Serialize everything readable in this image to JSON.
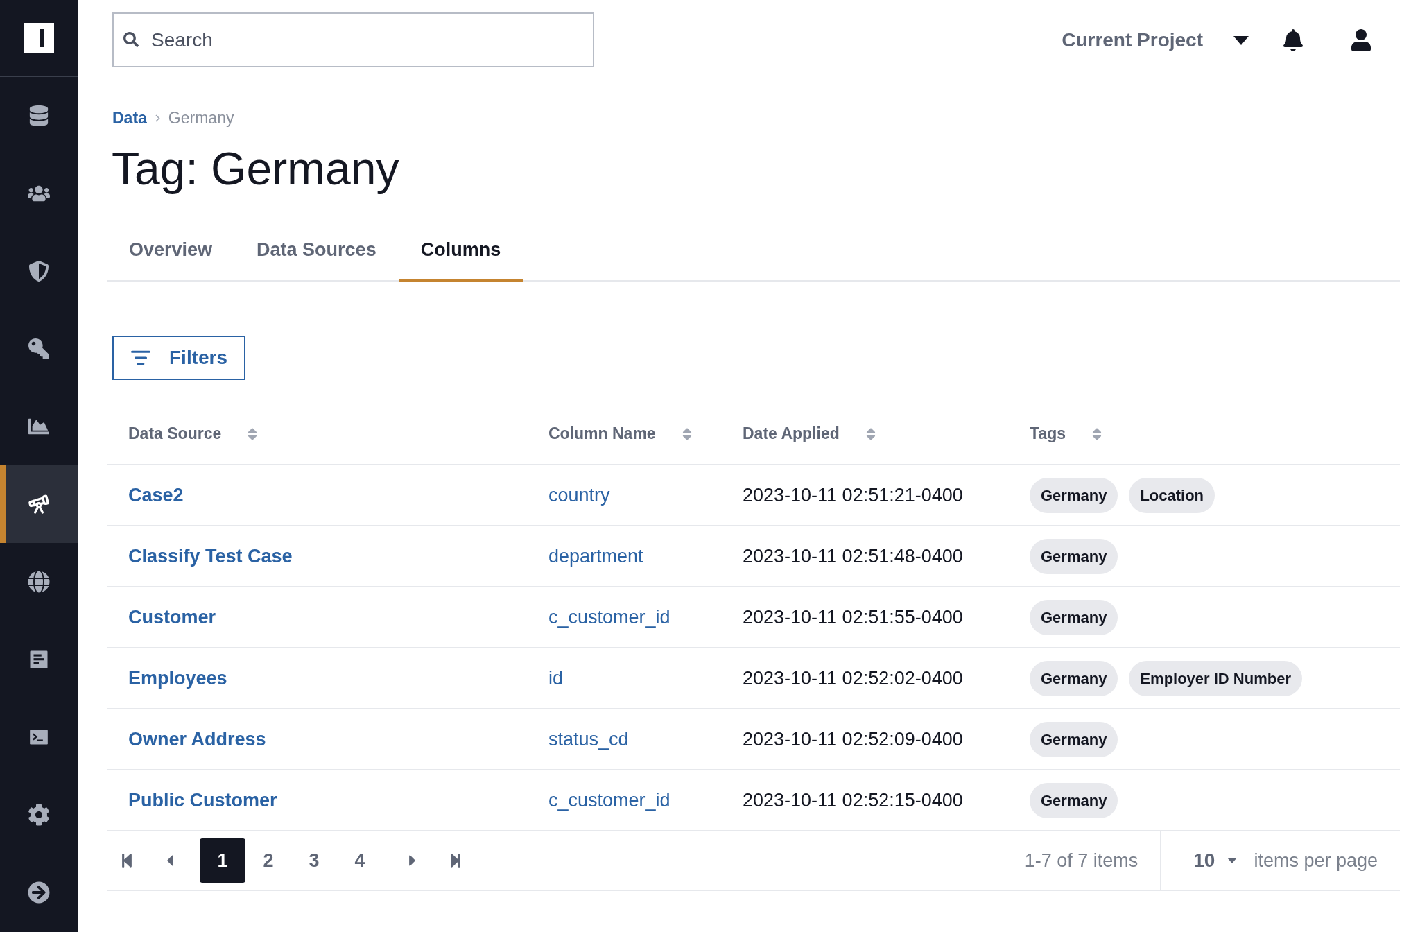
{
  "sidebar": {
    "items": [
      {
        "selected": false
      },
      {
        "selected": false
      },
      {
        "selected": false
      },
      {
        "selected": false
      },
      {
        "selected": false
      },
      {
        "selected": true
      },
      {
        "selected": false
      },
      {
        "selected": false
      },
      {
        "selected": false
      },
      {
        "selected": false
      },
      {
        "selected": false
      }
    ]
  },
  "header": {
    "search": {
      "placeholder": "Search"
    },
    "project": "Current Project"
  },
  "breadcrumb": [
    "Data",
    "Germany"
  ],
  "title": "Tag: Germany",
  "tabs": [
    {
      "label": "Overview",
      "selected": false
    },
    {
      "label": "Data Sources",
      "selected": false
    },
    {
      "label": "Columns",
      "selected": true
    }
  ],
  "filters_button": "Filters",
  "table": {
    "columns": [
      "Data Source",
      "Column Name",
      "Date Applied",
      "Tags"
    ],
    "rows": [
      {
        "data_source": "Case2",
        "column_name": "country",
        "date_applied": "2023-10-11 02:51:21-0400",
        "tags": [
          "Germany",
          "Location"
        ]
      },
      {
        "data_source": "Classify Test Case",
        "column_name": "department",
        "date_applied": "2023-10-11 02:51:48-0400",
        "tags": [
          "Germany"
        ]
      },
      {
        "data_source": "Customer",
        "column_name": "c_customer_id",
        "date_applied": "2023-10-11 02:51:55-0400",
        "tags": [
          "Germany"
        ]
      },
      {
        "data_source": "Employees",
        "column_name": "id",
        "date_applied": "2023-10-11 02:52:02-0400",
        "tags": [
          "Germany",
          "Employer ID Number"
        ]
      },
      {
        "data_source": "Owner Address",
        "column_name": "status_cd",
        "date_applied": "2023-10-11 02:52:09-0400",
        "tags": [
          "Germany"
        ]
      },
      {
        "data_source": "Public Customer",
        "column_name": "c_customer_id",
        "date_applied": "2023-10-11 02:52:15-0400",
        "tags": [
          "Germany"
        ]
      }
    ]
  },
  "pagination": {
    "pages": [
      {
        "label": "1",
        "selected": true
      },
      {
        "label": "2",
        "selected": false
      },
      {
        "label": "3",
        "selected": false
      },
      {
        "label": "4",
        "selected": false
      }
    ],
    "summary": "1-7 of 7 items",
    "page_size": "10",
    "page_size_label": "items per page"
  }
}
